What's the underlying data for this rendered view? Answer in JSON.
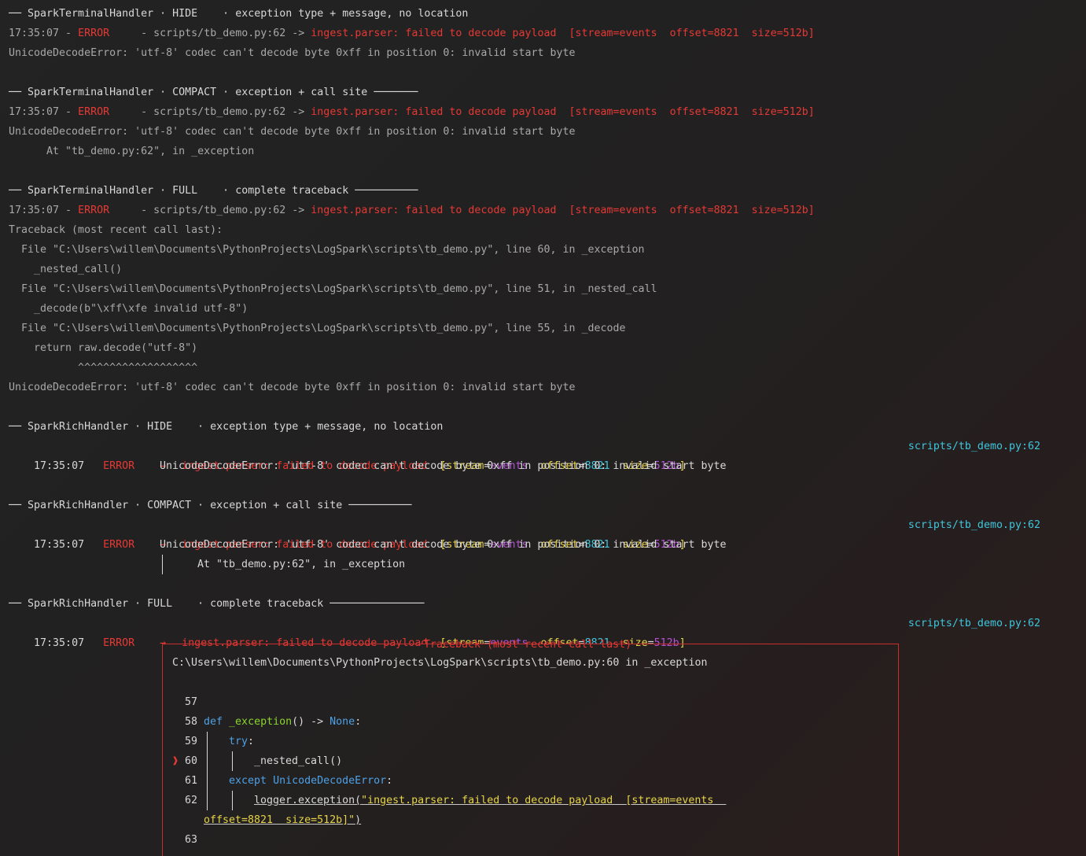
{
  "sections": [
    {
      "header": "── SparkTerminalHandler · HIDE    · exception type + message, no location",
      "line": {
        "time": "17:35:07",
        "sep1": " - ",
        "level": "ERROR",
        "mid": "     - scripts/tb_demo.py:62 -> ",
        "msg": "ingest.parser: failed to decode payload  [stream=events  offset=8821  size=512b]"
      },
      "exc": "UnicodeDecodeError: 'utf-8' codec can't decode byte 0xff in position 0: invalid start byte"
    },
    {
      "header": "── SparkTerminalHandler · COMPACT · exception + call site ───────",
      "line": {
        "time": "17:35:07",
        "sep1": " - ",
        "level": "ERROR",
        "mid": "     - scripts/tb_demo.py:62 -> ",
        "msg": "ingest.parser: failed to decode payload  [stream=events  offset=8821  size=512b]"
      },
      "exc": "UnicodeDecodeError: 'utf-8' codec can't decode byte 0xff in position 0: invalid start byte",
      "at": "      At \"tb_demo.py:62\", in _exception"
    },
    {
      "header": "── SparkTerminalHandler · FULL    · complete traceback ──────────",
      "line": {
        "time": "17:35:07",
        "sep1": " - ",
        "level": "ERROR",
        "mid": "     - scripts/tb_demo.py:62 -> ",
        "msg": "ingest.parser: failed to decode payload  [stream=events  offset=8821  size=512b]"
      },
      "traceback": [
        "Traceback (most recent call last):",
        "  File \"C:\\Users\\willem\\Documents\\PythonProjects\\LogSpark\\scripts\\tb_demo.py\", line 60, in _exception",
        "    _nested_call()",
        "  File \"C:\\Users\\willem\\Documents\\PythonProjects\\LogSpark\\scripts\\tb_demo.py\", line 51, in _nested_call",
        "    _decode(b\"\\xff\\xfe invalid utf-8\")",
        "  File \"C:\\Users\\willem\\Documents\\PythonProjects\\LogSpark\\scripts\\tb_demo.py\", line 55, in _decode",
        "    return raw.decode(\"utf-8\")",
        "           ^^^^^^^^^^^^^^^^^^^",
        "UnicodeDecodeError: 'utf-8' codec can't decode byte 0xff in position 0: invalid start byte"
      ]
    },
    {
      "header": "── SparkRichHandler · HIDE    · exception type + message, no location",
      "exc": "UnicodeDecodeError: 'utf-8' codec can't decode byte 0xff in position 0: invalid start byte"
    },
    {
      "header": "── SparkRichHandler · COMPACT · exception + call site ──────────",
      "exc": "UnicodeDecodeError: 'utf-8' codec can't decode byte 0xff in position 0: invalid start byte",
      "at": "At \"tb_demo.py:62\", in _exception"
    },
    {
      "header": "── SparkRichHandler · FULL    · complete traceback ───────────────"
    }
  ],
  "rich_line": {
    "time": "17:35:07",
    "level": "ERROR",
    "arrow": "→",
    "msg": "ingest.parser: failed to decode payload",
    "open": "[",
    "k1": "stream",
    "eq": "=",
    "v1": "events",
    "k2": "offset",
    "v2": "8821",
    "k3": "size",
    "v3": "512b",
    "close": "]",
    "location": "scripts/tb_demo.py:62"
  },
  "rich_traceback": {
    "title": "Traceback (most recent call last)",
    "file": "C:\\Users\\willem\\Documents\\PythonProjects\\LogSpark\\scripts\\tb_demo.py:60 in _exception",
    "error_marker": "❱",
    "code": [
      {
        "no": "57",
        "text": ""
      },
      {
        "no": "58",
        "kw": "def",
        "name": "_exception",
        "rest": "() -> ",
        "type": "None",
        "colon": ":"
      },
      {
        "no": "59",
        "kw": "try",
        "colon": ":"
      },
      {
        "no": "60",
        "text": "_nested_call()"
      },
      {
        "no": "61",
        "kw": "except",
        "type": "UnicodeDecodeError",
        "colon": ":"
      },
      {
        "no": "62",
        "call": "logger.exception(",
        "str1": "\"ingest.parser: failed to decode payload  [stream=events  ",
        "str2": "offset=8821  size=512b]\"",
        "close": ")"
      },
      {
        "no": "63",
        "text": ""
      }
    ]
  }
}
